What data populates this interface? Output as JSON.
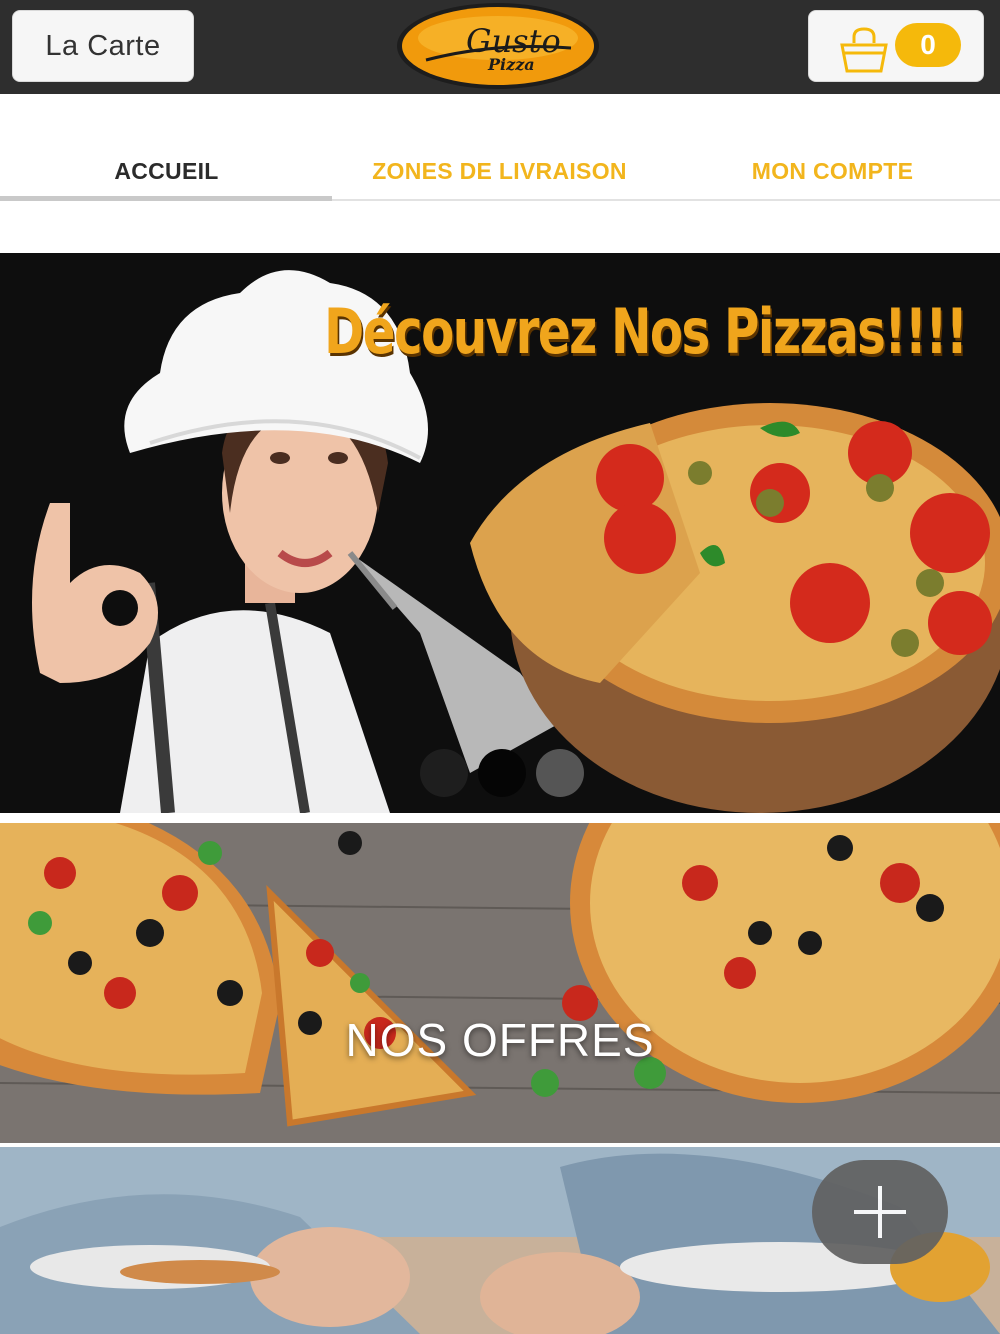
{
  "header": {
    "menu_button_label": "La Carte",
    "logo": {
      "word1": "Gusto",
      "word2": "Pizza"
    },
    "cart": {
      "icon": "shopping-bag-icon",
      "count": "0"
    }
  },
  "tabs": [
    {
      "label": "ACCUEIL",
      "active": true
    },
    {
      "label": "ZONES DE LIVRAISON",
      "active": false
    },
    {
      "label": "MON COMPTE",
      "active": false
    }
  ],
  "hero": {
    "title": "Découvrez Nos Pizzas!!!!",
    "slides_total": 3,
    "active_slide": 2
  },
  "offers": {
    "label": "NOS OFFRES"
  },
  "fab": {
    "icon": "plus-icon"
  },
  "colors": {
    "header_bg": "#2e2e2e",
    "accent": "#f5b90b",
    "tab_inactive": "#f2b51d",
    "tab_active": "#2b2b2b"
  }
}
